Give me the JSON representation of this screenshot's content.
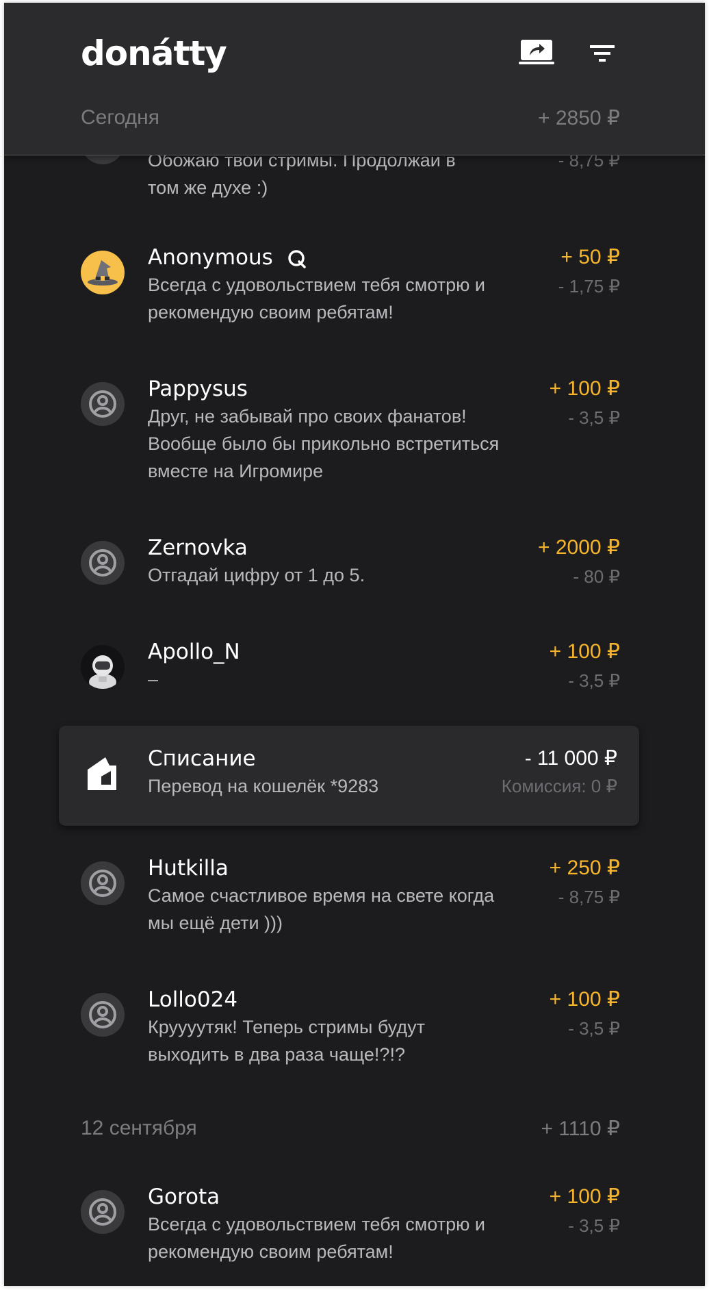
{
  "app": {
    "logo_text": "donátty"
  },
  "header": {
    "today_label": "Сегодня",
    "today_total": "+ 2850 ₽",
    "share_icon": "share-screen-icon",
    "filter_icon": "filter-icon"
  },
  "colors": {
    "background": "#1c1c1e",
    "header": "#2b2b2d",
    "accent_amount": "#f6b52c",
    "muted": "#7c7c80"
  },
  "partial_item": {
    "message_top": "Обожаю твои стримы. Продолжай в",
    "message_bottom": "том же духе :)",
    "fee": "- 8,75 ₽"
  },
  "donations": [
    {
      "name": "Anonymous",
      "message": "Всегда с удовольствием тебя смотрю и рекомендую своим ребятам!",
      "amount": "+ 50 ₽",
      "fee": "- 1,75 ₽",
      "avatar": "wizard-hat-avatar"
    },
    {
      "name": "Pappysus",
      "message": "Друг, не забывай про своих фанатов! Вообще было бы прикольно встретиться вместе на Игромире",
      "amount": "+ 100 ₽",
      "fee": "- 3,5 ₽",
      "avatar": "user-circle-icon"
    },
    {
      "name": "Zernovka",
      "message": "Отгадай цифру от 1 до 5.",
      "amount": "+ 2000 ₽",
      "fee": "- 80 ₽",
      "avatar": "user-circle-icon"
    },
    {
      "name": "Apollo_N",
      "message": "–",
      "amount": "+ 100 ₽",
      "fee": "- 3,5 ₽",
      "avatar": "astronaut-avatar"
    }
  ],
  "withdrawal": {
    "title": "Списание",
    "subtitle": "Перевод на кошелёк *9283",
    "amount": "- 11 000 ₽",
    "commission": "Комиссия: 0 ₽",
    "icon": "wallet-icon"
  },
  "donations_after": [
    {
      "name": "Hutkilla",
      "message": "Самое счастливое время на свете когда мы ещё дети )))",
      "amount": "+ 250 ₽",
      "fee": "- 8,75 ₽",
      "avatar": "user-circle-icon"
    },
    {
      "name": "Lollo024",
      "message": "Круууутяк! Теперь стримы будут выходить в два раза чаще!?!?",
      "amount": "+ 100 ₽",
      "fee": "- 3,5 ₽",
      "avatar": "user-circle-icon"
    }
  ],
  "section2": {
    "date_label": "12 сентября",
    "total": "+ 1110 ₽"
  },
  "donations_section2": [
    {
      "name": "Gorota",
      "message": "Всегда с удовольствием тебя смотрю и рекомендую своим ребятам!",
      "amount": "+ 100 ₽",
      "fee": "- 3,5 ₽",
      "avatar": "user-circle-icon"
    }
  ]
}
